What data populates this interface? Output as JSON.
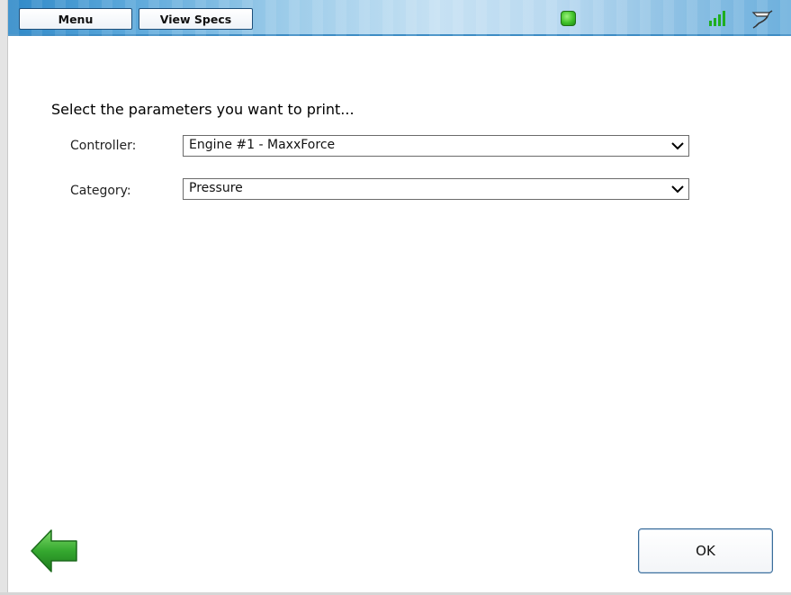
{
  "toolbar": {
    "menu_label": "Menu",
    "view_specs_label": "View Specs",
    "status_icon": "status-led-green",
    "signal_icon": "signal-strength-icon",
    "connection_icon": "vehicle-connector-icon",
    "colors": {
      "bar": "#6db0dd",
      "led": "#3fc128",
      "signal": "#1fae1f"
    }
  },
  "main": {
    "heading": "Select the parameters you want to print...",
    "fields": [
      {
        "label": "Controller:",
        "value": "Engine #1 - MaxxForce"
      },
      {
        "label": "Category:",
        "value": "Pressure"
      }
    ]
  },
  "footer": {
    "back_icon": "back-arrow-icon",
    "ok_label": "OK",
    "colors": {
      "back_arrow": "#2e9e2e"
    }
  }
}
